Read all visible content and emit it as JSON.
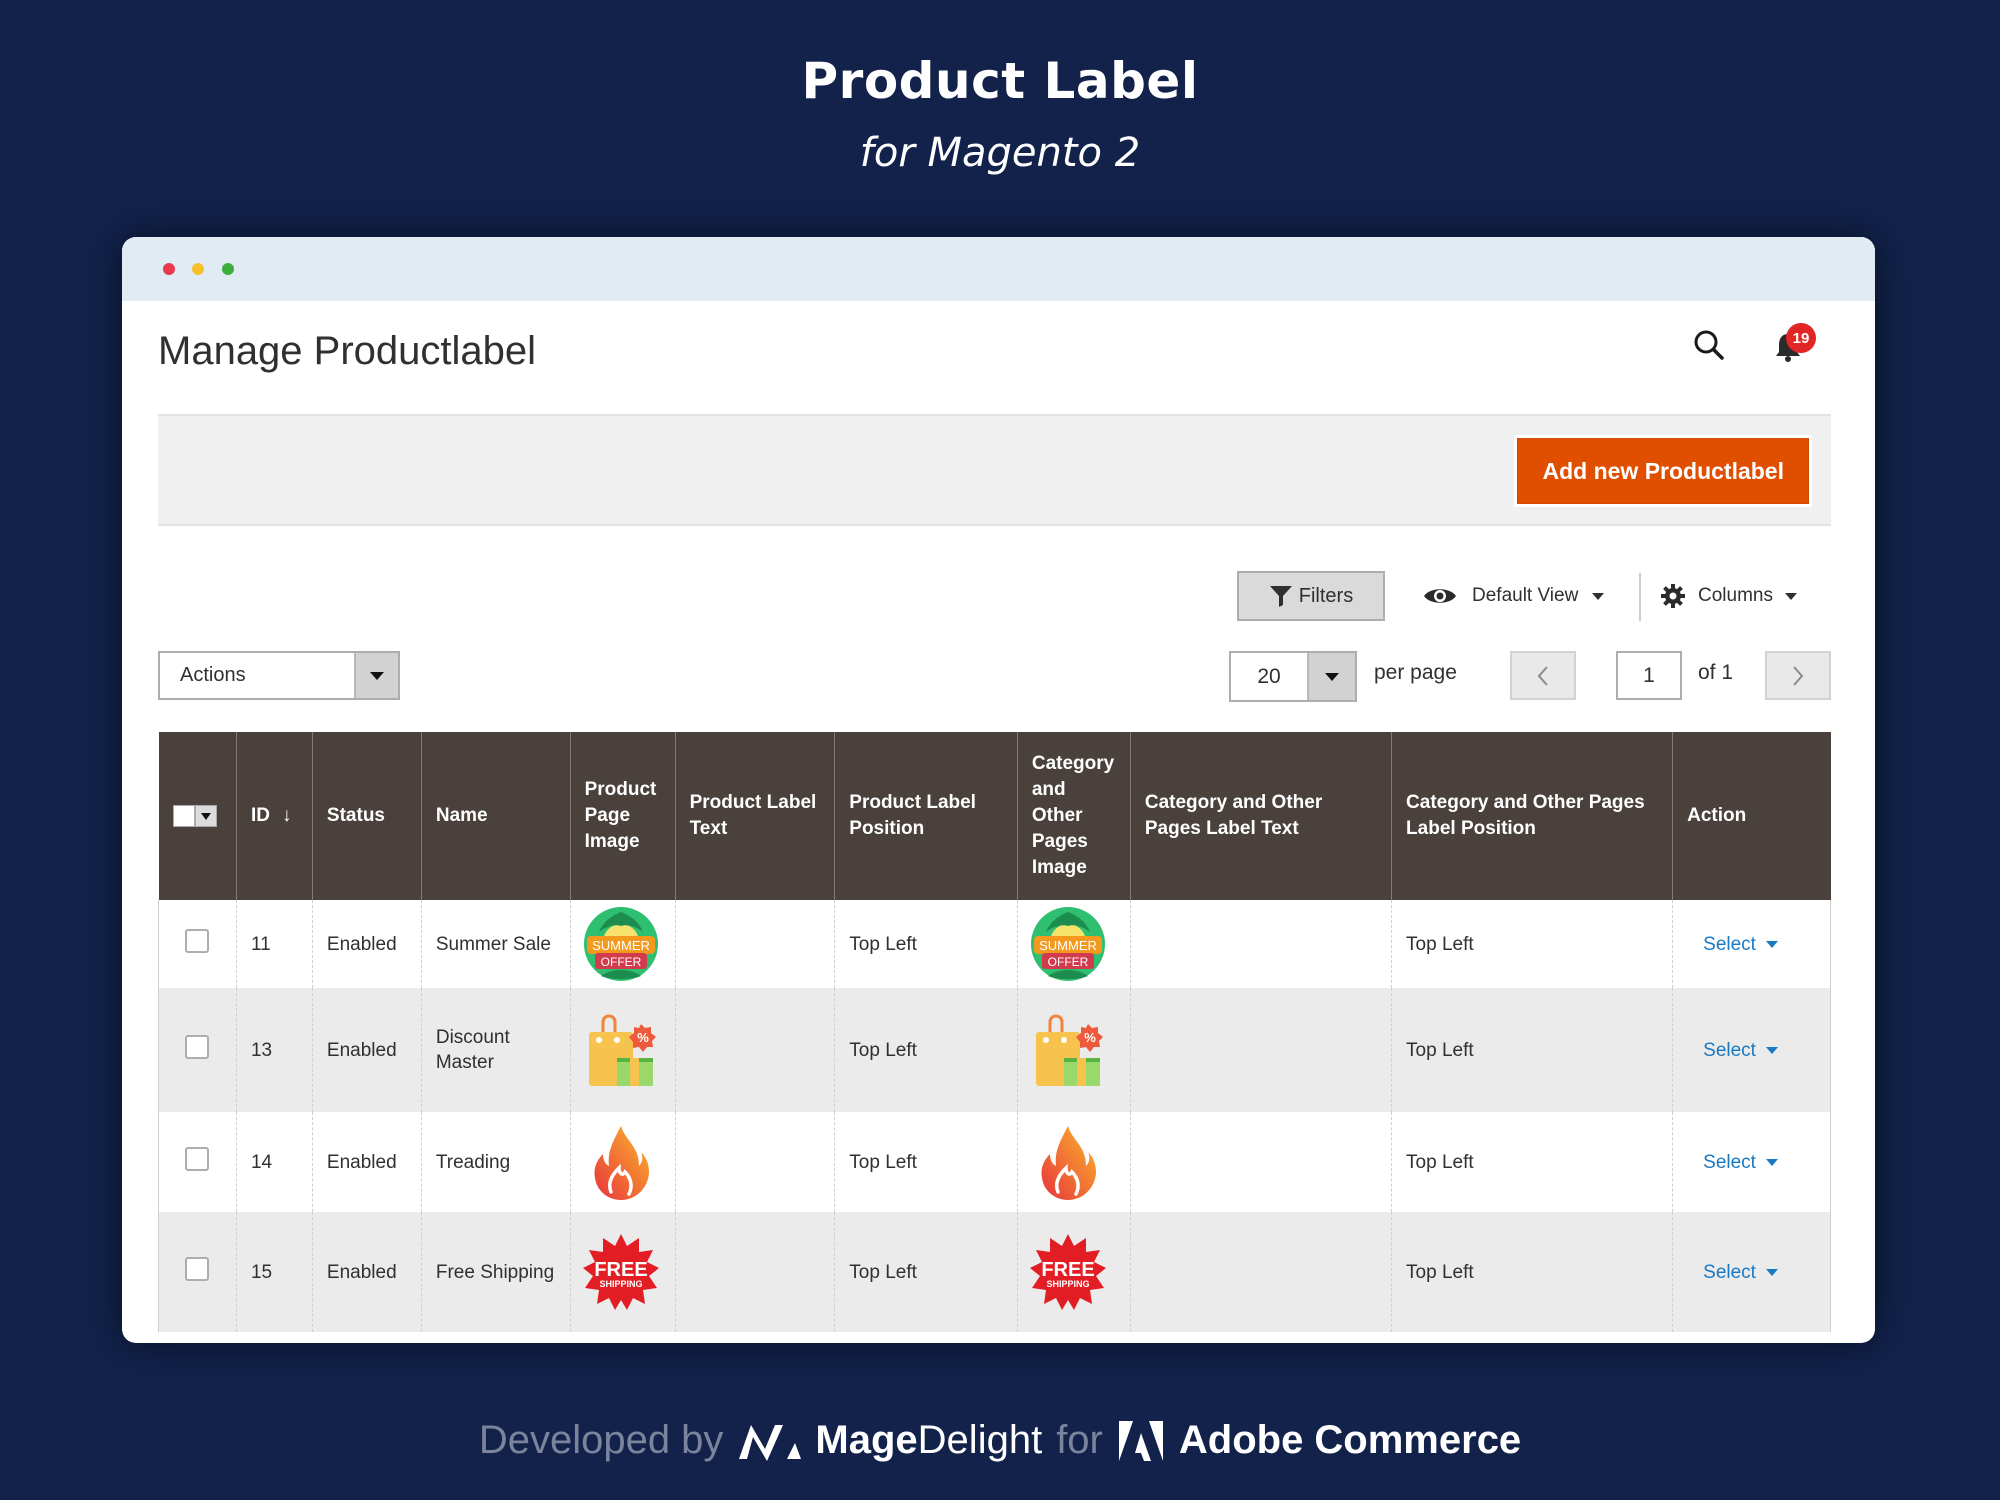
{
  "hero": {
    "title": "Product Label",
    "subtitle": "for Magento 2"
  },
  "window": {
    "traffic_lights": [
      "close",
      "minimize",
      "maximize"
    ]
  },
  "header": {
    "page_title": "Manage Productlabel",
    "search_icon": "search-icon",
    "notifications_icon": "bell-icon",
    "notifications_count": "19"
  },
  "action_bar": {
    "add_button_label": "Add new Productlabel",
    "add_button_color": "#e04f00"
  },
  "toolbar": {
    "filters_label": "Filters",
    "view_label": "Default View",
    "columns_label": "Columns"
  },
  "mass_actions": {
    "label": "Actions"
  },
  "pagination": {
    "per_page_value": "20",
    "per_page_label": "per page",
    "current_page": "1",
    "total_pages_label": "of 1"
  },
  "grid": {
    "header_bg": "#4a413d",
    "link_color": "#1979c3",
    "columns": [
      {
        "key": "select",
        "label": ""
      },
      {
        "key": "id",
        "label": "ID",
        "sorted": "descending"
      },
      {
        "key": "status",
        "label": "Status"
      },
      {
        "key": "name",
        "label": "Name"
      },
      {
        "key": "product_page_image",
        "label": "Product Page Image"
      },
      {
        "key": "product_label_text",
        "label": "Product Label Text"
      },
      {
        "key": "product_label_position",
        "label": "Product Label Position"
      },
      {
        "key": "category_image",
        "label": "Category and Other Pages Image"
      },
      {
        "key": "category_label_text",
        "label": "Category and Other Pages Label Text"
      },
      {
        "key": "category_label_position",
        "label": "Category and Other Pages Label Position"
      },
      {
        "key": "action",
        "label": "Action"
      }
    ],
    "rows": [
      {
        "id": "11",
        "status": "Enabled",
        "name": "Summer Sale",
        "product_page_image": "summer-offer-badge",
        "product_label_text": "",
        "product_label_position": "Top Left",
        "category_image": "summer-offer-badge",
        "category_label_text": "",
        "category_label_position": "Top Left",
        "action": "Select",
        "badge_text": [
          "SUMMER",
          "OFFER"
        ]
      },
      {
        "id": "13",
        "status": "Enabled",
        "name": "Discount Master",
        "product_page_image": "shopping-bag-gift-discount-badge",
        "product_label_text": "",
        "product_label_position": "Top Left",
        "category_image": "shopping-bag-gift-discount-badge",
        "category_label_text": "",
        "category_label_position": "Top Left",
        "action": "Select",
        "badge_text": [
          "%"
        ]
      },
      {
        "id": "14",
        "status": "Enabled",
        "name": "Treading",
        "product_page_image": "fire-badge",
        "product_label_text": "",
        "product_label_position": "Top Left",
        "category_image": "fire-badge",
        "category_label_text": "",
        "category_label_position": "Top Left",
        "action": "Select",
        "badge_text": []
      },
      {
        "id": "15",
        "status": "Enabled",
        "name": "Free Shipping",
        "product_page_image": "free-shipping-badge",
        "product_label_text": "",
        "product_label_position": "Top Left",
        "category_image": "free-shipping-badge",
        "category_label_text": "",
        "category_label_position": "Top Left",
        "action": "Select",
        "badge_text": [
          "FREE",
          "SHIPPING"
        ]
      }
    ]
  },
  "footer": {
    "developed_by": "Developed by",
    "brand_bold": "Mage",
    "brand_light": "Delight",
    "for": "for",
    "platform": "Adobe Commerce"
  }
}
